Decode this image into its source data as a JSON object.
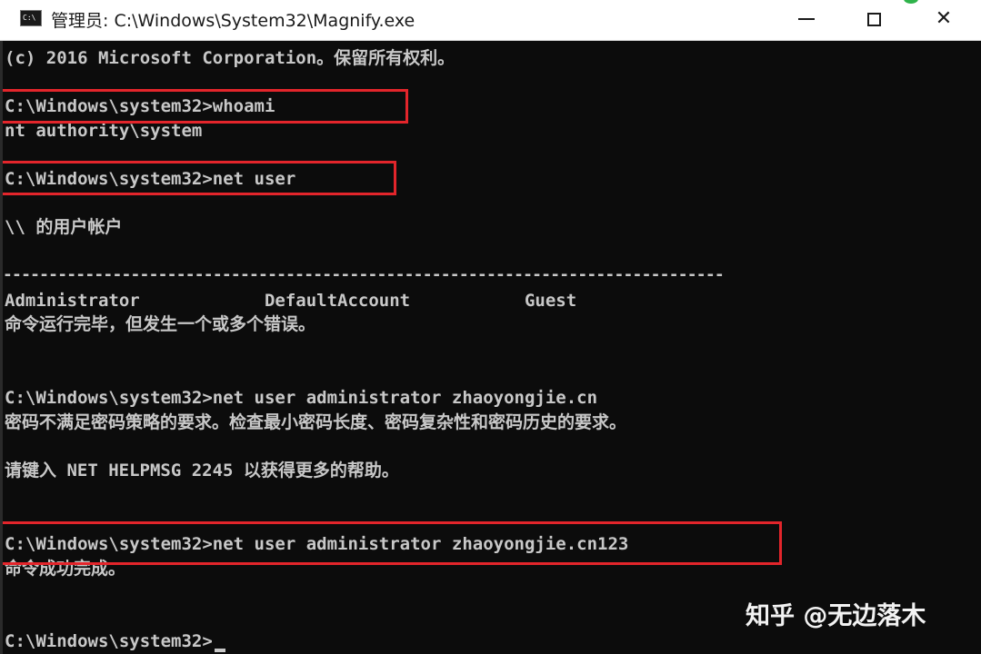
{
  "window": {
    "title": "管理员: C:\\Windows\\System32\\Magnify.exe",
    "app_icon_text": "C:\\",
    "controls": {
      "minimize": "minimize",
      "maximize": "maximize",
      "close": "✕"
    }
  },
  "console": {
    "lines": {
      "copyright": "(c) 2016 Microsoft Corporation。保留所有权利。",
      "cmd_whoami": "C:\\Windows\\system32>whoami",
      "out_whoami": "nt authority\\system",
      "cmd_net_user": "C:\\Windows\\system32>net user",
      "user_accounts_header": "\\\\ 的用户帐户",
      "separator": "-------------------------------------------------------------------------------",
      "accounts_row": "Administrator            DefaultAccount           Guest",
      "error_msg": "命令运行完毕，但发生一个或多个错误。",
      "cmd_set_pw1": "C:\\Windows\\system32>net user administrator zhaoyongjie.cn",
      "pw_policy_error": "密码不满足密码策略的要求。检查最小密码长度、密码复杂性和密码历史的要求。",
      "helpmsg": "请键入 NET HELPMSG 2245 以获得更多的帮助。",
      "cmd_set_pw2": "C:\\Windows\\system32>net user administrator zhaoyongjie.cn123",
      "success_msg": "命令成功完成。",
      "prompt": "C:\\Windows\\system32>"
    }
  },
  "watermark": "知乎 @无边落木",
  "colors": {
    "console_bg": "#0c0c0c",
    "console_text": "#c8c8c8",
    "highlight_border": "#e3252b",
    "titlebar_bg": "#ffffff"
  }
}
